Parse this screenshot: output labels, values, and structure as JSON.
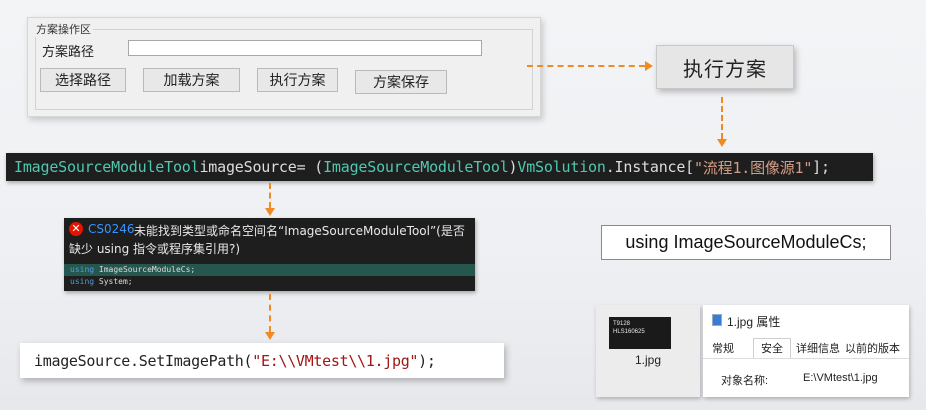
{
  "panel": {
    "group_title": "方案操作区",
    "path_label": "方案路径",
    "path_value": "",
    "buttons": [
      "选择路径",
      "加载方案",
      "执行方案",
      "方案保存"
    ]
  },
  "big_button": "执行方案",
  "code_line": {
    "type1": "ImageSourceModuleTool",
    "var": " imageSource",
    "eq": " = (",
    "type2": "ImageSourceModuleTool",
    "close": ")",
    "type3": "VmSolution",
    "dot": ".Instance[",
    "str": "\"流程1.图像源1\"",
    "end": "];"
  },
  "error": {
    "icon": "error-circle-icon",
    "code": "CS0246",
    "line1": "未能找到类型或命名空间名“ImageSourceModuleTool”(是否",
    "line2": "缺少 using 指令或程序集引用?)",
    "using1_kw": "using",
    "using1_ns": " ImageSourceModuleCs;",
    "using2_kw": "using",
    "using2_ns": " System;"
  },
  "set_path": {
    "prefix": "imageSource.SetImagePath(",
    "str": "\"E:\\\\VMtest\\\\1.jpg\"",
    "suffix": ");"
  },
  "using_statement": "using ImageSourceModuleCs;",
  "file_thumb": {
    "text1": "T9128",
    "text2": "HLS160625",
    "name": "1.jpg"
  },
  "properties": {
    "title": "1.jpg 属性",
    "tabs": [
      "常规",
      "安全",
      "详细信息",
      "以前的版本"
    ],
    "object_label": "对象名称:",
    "object_value": "E:\\VMtest\\1.jpg"
  },
  "colors": {
    "connector": "#f08a22",
    "code_bg": "#1e1e1e",
    "type_color": "#4ec9b0",
    "string_color": "#d69d85",
    "error_code": "#3794ff"
  }
}
